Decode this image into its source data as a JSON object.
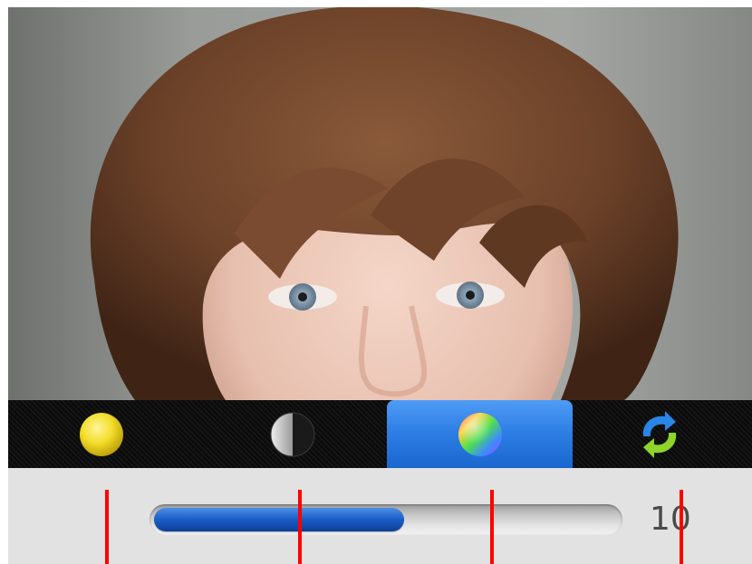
{
  "photo": {
    "subject": "portrait-photo"
  },
  "toolbar": {
    "tools": [
      {
        "name": "brightness",
        "icon": "yellow-circle-icon",
        "active": false
      },
      {
        "name": "contrast",
        "icon": "half-circle-contrast-icon",
        "active": false
      },
      {
        "name": "saturation",
        "icon": "color-wheel-icon",
        "active": true
      },
      {
        "name": "reset",
        "icon": "refresh-arrows-icon",
        "active": false
      }
    ]
  },
  "adjustment": {
    "value": "10",
    "level": 0.54
  },
  "colors": {
    "accent": "#2f7fe6",
    "marker": "#ff0000",
    "panel": "#e2e2e2"
  }
}
